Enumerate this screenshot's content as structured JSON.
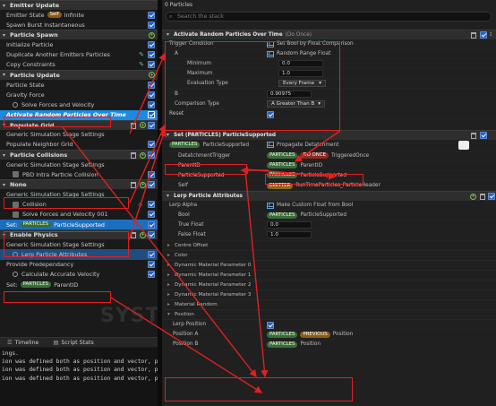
{
  "left": {
    "sections": [
      {
        "title": "Emitter Update",
        "rows": [
          {
            "label": "Emitter State",
            "badge": "Self",
            "badge_value": "Infinite"
          },
          {
            "label": "Spawn Burst Instantaneous"
          }
        ]
      },
      {
        "title": "Particle Spawn",
        "rows": [
          {
            "label": "Initialize Particle"
          },
          {
            "label": "Duplicate Another Emitters Particles"
          },
          {
            "label": "Copy Constraints"
          }
        ]
      },
      {
        "title": "Particle Update",
        "rows": [
          {
            "label": "Particle State"
          },
          {
            "label": "Gravity Force"
          },
          {
            "label": "Solve Forces and Velocity"
          },
          {
            "label": "Activate Random Particles Over Time"
          }
        ]
      },
      {
        "title": "Populate Grid",
        "rows": [
          {
            "label": "Generic Simulation Stage Settings"
          },
          {
            "label": "Populate Neighbor Grid"
          }
        ]
      },
      {
        "title": "Particle Collisions",
        "rows": [
          {
            "label": "Generic Simulation Stage Settings"
          },
          {
            "label": "PBD Intra Particle Collision"
          }
        ]
      },
      {
        "title": "None",
        "rows": [
          {
            "label": "Generic Simulation Stage Settings"
          },
          {
            "label": "Collision"
          },
          {
            "label": "Solve Forces and Velocity 001"
          },
          {
            "label": "Set:",
            "pill": "PARTICLES",
            "value": "ParticleSupported"
          }
        ]
      },
      {
        "title": "Enable Physics",
        "rows": [
          {
            "label": "Generic Simulation Stage Settings"
          },
          {
            "label": "Lerp Particle Attributes"
          },
          {
            "label": "Provide Predependancy"
          },
          {
            "label": "Calculate Accurate Velocity"
          },
          {
            "label": "Set:",
            "pill": "PARTICLES",
            "value": "ParentID"
          }
        ]
      }
    ],
    "watermark": "SYSTEM",
    "tabs": [
      "Timeline",
      "Script Stats"
    ],
    "log": [
      "ings.",
      "ion was defined both as position and vector, pl",
      "ion was defined both as position and vector, pl",
      "ion was defined both as position and vector, pl"
    ]
  },
  "right": {
    "title": "0 Particles",
    "search_placeholder": "Search the stack",
    "module1": {
      "title": "Activate Random Particles Over Time",
      "tag": "(Do Once)",
      "rows": {
        "trigger_label": "Trigger Condition",
        "trigger_value": "Set Bool by Float Comparison",
        "a_label": "A",
        "a_value": "Random Range Float",
        "min_label": "Minimum",
        "min_value": "0.0",
        "max_label": "Maximum",
        "max_value": "1.0",
        "eval_label": "Evaluation Type",
        "eval_value": "Every Frame",
        "b_label": "B",
        "b_value": "0.90975",
        "cmp_label": "Comparison Type",
        "cmp_value": "A Greater Than B",
        "reset_label": "Reset"
      }
    },
    "module2": {
      "title": "Set (PARTICLES) ParticleSupported",
      "header_pill": "PARTICLES",
      "header_attr": "ParticleSupported",
      "header_value": "Propagate Detatchment",
      "rows": [
        {
          "label": "DetatchmentTrigger",
          "pill": "PARTICLES",
          "pill2": "DO ONCE",
          "value": "TriggeredOnce"
        },
        {
          "label": "ParentID",
          "pill": "PARTICLES",
          "value": "ParentID"
        },
        {
          "label": "ParticleSupported",
          "pill": "PARTICLES",
          "value": "ParticleSupported"
        },
        {
          "label": "Self",
          "pill": "EMITTER",
          "value": "RunTimeParticles_ParticleReader"
        }
      ]
    },
    "module3": {
      "title": "Lerp Particle Attributes",
      "rows": [
        {
          "label": "Lerp Alpha",
          "value": "Make Custom Float from Bool"
        },
        {
          "label": "Bool",
          "pill": "PARTICLES",
          "value": "ParticleSupported"
        },
        {
          "label": "True Float",
          "value": "0.0"
        },
        {
          "label": "False Float",
          "value": "1.0"
        }
      ],
      "collapsed": [
        "Centre Offset",
        "Color",
        "Dynamic Material Parameter 0",
        "Dynamic Material Parameter 1",
        "Dynamic Material Parameter 2",
        "Dynamic Material Parameter 3",
        "Material Random",
        "Position"
      ],
      "lerp_position_label": "Lerp Position",
      "position_a_label": "Position A",
      "position_a_pill": "PARTICLES",
      "position_a_pill2": "PREVIOUS",
      "position_a_value": "Position",
      "position_b_label": "Position B",
      "position_b_pill": "PARTICLES",
      "position_b_value": "Position"
    }
  },
  "colors": {
    "accent": "#1b8ae0",
    "annotation": "#e02020",
    "pill_green": "#3b6b3b"
  }
}
